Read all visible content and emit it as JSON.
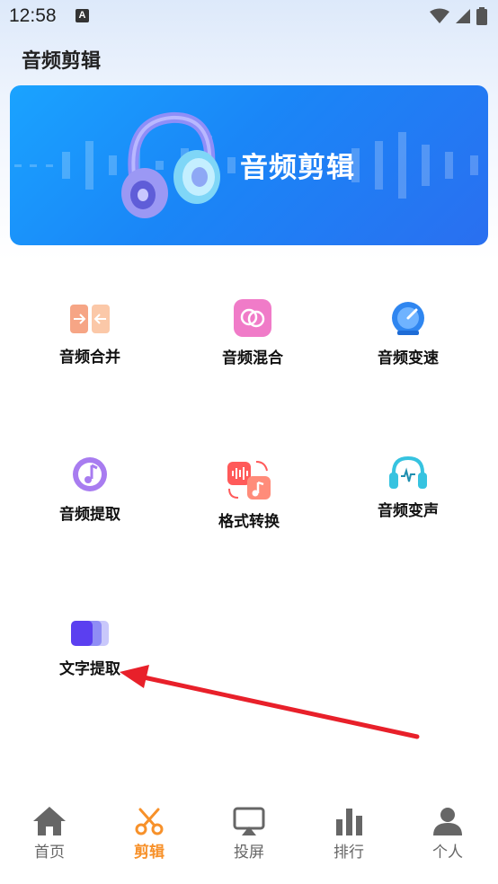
{
  "status_bar": {
    "time": "12:58",
    "notification_icon": "A"
  },
  "page": {
    "title": "音频剪辑"
  },
  "banner": {
    "title": "音频剪辑"
  },
  "tools": [
    {
      "label": "音频合并",
      "icon": "merge-icon"
    },
    {
      "label": "音频混合",
      "icon": "mix-icon"
    },
    {
      "label": "音频变速",
      "icon": "speed-icon"
    },
    {
      "label": "音频提取",
      "icon": "extract-icon"
    },
    {
      "label": "格式转换",
      "icon": "convert-icon"
    },
    {
      "label": "音频变声",
      "icon": "voice-change-icon"
    },
    {
      "label": "文字提取",
      "icon": "text-extract-icon"
    }
  ],
  "bottom_nav": [
    {
      "label": "首页",
      "icon": "home-icon"
    },
    {
      "label": "剪辑",
      "icon": "scissors-icon",
      "active": true
    },
    {
      "label": "投屏",
      "icon": "cast-icon"
    },
    {
      "label": "排行",
      "icon": "bar-chart-icon"
    },
    {
      "label": "个人",
      "icon": "person-icon"
    }
  ],
  "colors": {
    "accent": "#f7912a",
    "banner": "#1a86f7",
    "annotation_arrow": "#e8202a"
  }
}
